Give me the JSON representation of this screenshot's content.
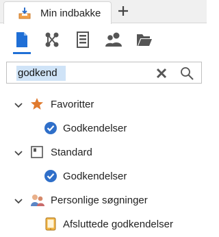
{
  "tabbar": {
    "active_tab": {
      "label": "Min indbakke",
      "icon": "inbox-download-icon"
    },
    "new_tab_icon": "plus-icon"
  },
  "toolbar": {
    "buttons": [
      {
        "name": "document-icon",
        "active": true
      },
      {
        "name": "workflow-icon",
        "active": false
      },
      {
        "name": "list-document-icon",
        "active": false
      },
      {
        "name": "people-icon",
        "active": false
      },
      {
        "name": "folder-icon",
        "active": false
      }
    ],
    "accent": "#1f6fd6"
  },
  "search": {
    "value": "godkend",
    "placeholder": "",
    "clear_icon": "close-icon",
    "search_icon": "search-icon"
  },
  "tree": {
    "groups": [
      {
        "label": "Favoritter",
        "icon": "star-icon",
        "expanded": true,
        "children": [
          {
            "label": "Godkendelser",
            "icon": "check-circle-icon"
          }
        ]
      },
      {
        "label": "Standard",
        "icon": "square-icon",
        "expanded": true,
        "children": [
          {
            "label": "Godkendelser",
            "icon": "check-circle-icon"
          }
        ]
      },
      {
        "label": "Personlige søgninger",
        "icon": "people-search-icon",
        "expanded": true,
        "children": [
          {
            "label": "Afsluttede godkendelser",
            "icon": "tablet-icon"
          }
        ]
      }
    ]
  },
  "colors": {
    "star": "#e07a2e",
    "check": "#2f6fc9",
    "icon_gray": "#555555"
  }
}
